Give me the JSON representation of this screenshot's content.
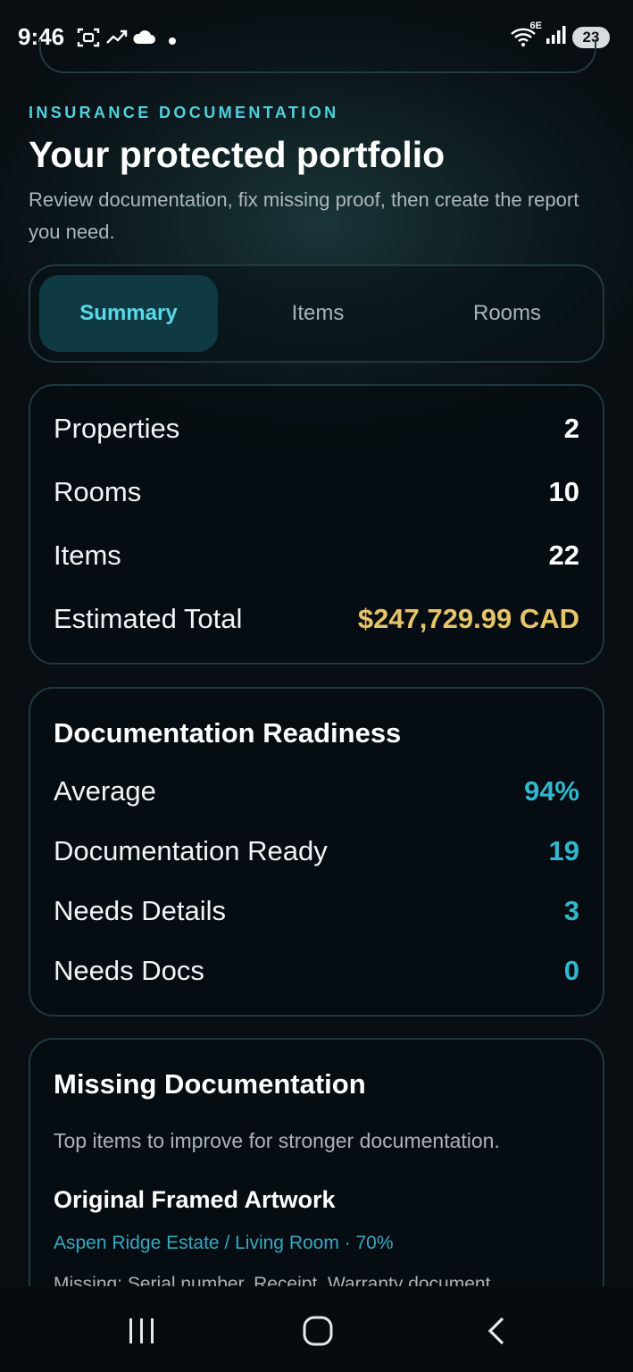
{
  "status": {
    "time": "9:46",
    "network": "6E",
    "battery": "23",
    "icons": [
      "screenshot-icon",
      "trending-icon",
      "cloud-icon",
      "dot-icon",
      "wifi-icon",
      "signal-icon",
      "battery-icon"
    ]
  },
  "header": {
    "section_label": "INSURANCE DOCUMENTATION",
    "title": "Your protected portfolio",
    "subtitle": "Review documentation, fix missing proof, then create the report you need."
  },
  "tabs": [
    {
      "label": "Summary",
      "active": true
    },
    {
      "label": "Items",
      "active": false
    },
    {
      "label": "Rooms",
      "active": false
    }
  ],
  "summary": {
    "rows": [
      {
        "label": "Properties",
        "value": "2"
      },
      {
        "label": "Rooms",
        "value": "10"
      },
      {
        "label": "Items",
        "value": "22"
      },
      {
        "label": "Estimated Total",
        "value": "$247,729.99 CAD"
      }
    ]
  },
  "readiness": {
    "title": "Documentation Readiness",
    "rows": [
      {
        "label": "Average",
        "value": "94%"
      },
      {
        "label": "Documentation Ready",
        "value": "19"
      },
      {
        "label": "Needs Details",
        "value": "3"
      },
      {
        "label": "Needs Docs",
        "value": "0"
      }
    ]
  },
  "missing": {
    "title": "Missing Documentation",
    "description": "Top items to improve for stronger documentation.",
    "items": [
      {
        "name": "Original Framed Artwork",
        "location": "Aspen Ridge Estate / Living Room · 70%",
        "missing": "Missing: Serial number, Receipt, Warranty document"
      }
    ]
  },
  "colors": {
    "accent_teal": "#4fd2de",
    "value_teal": "#2fb8cf",
    "gold": "#e6c469",
    "background": "#0a1418"
  },
  "nav": [
    "recent-apps-icon",
    "home-icon",
    "back-icon"
  ]
}
